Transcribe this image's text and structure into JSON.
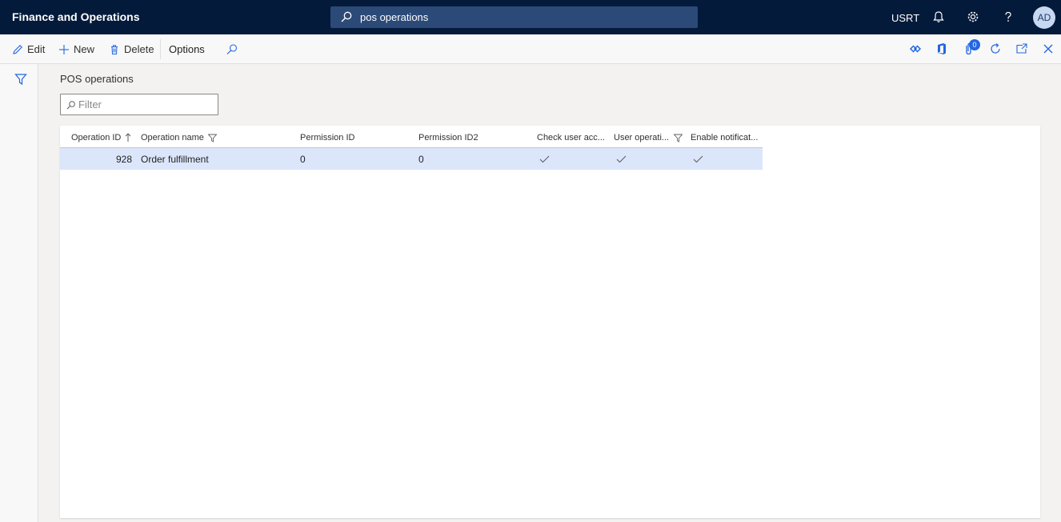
{
  "app": {
    "title": "Finance and Operations"
  },
  "search": {
    "value": "pos operations"
  },
  "user": {
    "company": "USRT",
    "initials": "AD"
  },
  "toolbar": {
    "edit": "Edit",
    "new": "New",
    "delete": "Delete",
    "options": "Options",
    "attachments_count": "0"
  },
  "page": {
    "title": "POS operations"
  },
  "filter": {
    "placeholder": "Filter"
  },
  "grid": {
    "columns": [
      "Operation ID",
      "Operation name",
      "Permission ID",
      "Permission ID2",
      "Check user acc...",
      "User operati...",
      "Enable notificat..."
    ],
    "rows": [
      {
        "operation_id": "928",
        "operation_name": "Order fulfillment",
        "permission_id": "0",
        "permission_id2": "0",
        "check_user_access": true,
        "user_operation": true,
        "enable_notification": true
      }
    ]
  },
  "colors": {
    "nav_bg": "#041a3a",
    "search_bg": "#2b4a78",
    "accent": "#2266e3",
    "selected_row": "#dce6fb"
  },
  "icons": [
    "search-icon",
    "bell-icon",
    "gear-icon",
    "help-icon",
    "edit-icon",
    "plus-icon",
    "trash-icon",
    "funnel-icon",
    "check-icon",
    "refresh-icon",
    "close-icon",
    "office-icon",
    "paperclip-icon",
    "open-new-window-icon",
    "diamond-icon"
  ]
}
